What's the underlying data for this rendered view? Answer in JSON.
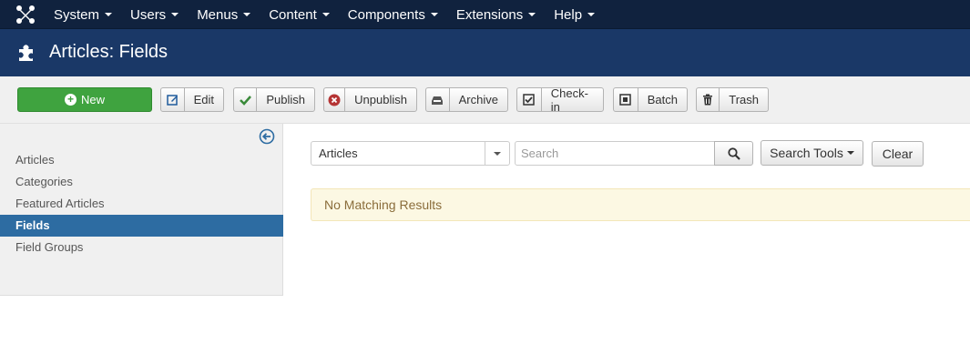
{
  "navbar": {
    "logo_icon": "joomla-logo-icon",
    "menu": [
      {
        "label": "System"
      },
      {
        "label": "Users"
      },
      {
        "label": "Menus"
      },
      {
        "label": "Content"
      },
      {
        "label": "Components"
      },
      {
        "label": "Extensions"
      },
      {
        "label": "Help"
      }
    ]
  },
  "header": {
    "icon": "puzzle-icon",
    "title": "Articles: Fields"
  },
  "toolbar": {
    "new_label": "New",
    "edit_label": "Edit",
    "publish_label": "Publish",
    "unpublish_label": "Unpublish",
    "archive_label": "Archive",
    "checkin_label": "Check-in",
    "batch_label": "Batch",
    "trash_label": "Trash"
  },
  "sidebar": {
    "toggle_icon": "collapse-left-icon",
    "items": [
      {
        "label": "Articles",
        "active": false
      },
      {
        "label": "Categories",
        "active": false
      },
      {
        "label": "Featured Articles",
        "active": false
      },
      {
        "label": "Fields",
        "active": true
      },
      {
        "label": "Field Groups",
        "active": false
      }
    ]
  },
  "filters": {
    "context_value": "Articles",
    "search_placeholder": "Search",
    "search_tools_label": "Search Tools",
    "clear_label": "Clear"
  },
  "message": {
    "text": "No Matching Results"
  },
  "colors": {
    "navbar": "#10223e",
    "header": "#1a3867",
    "new_button": "#3fa33f",
    "active_sidebar": "#2d6ca2",
    "alert_bg": "#fcf8e3"
  }
}
